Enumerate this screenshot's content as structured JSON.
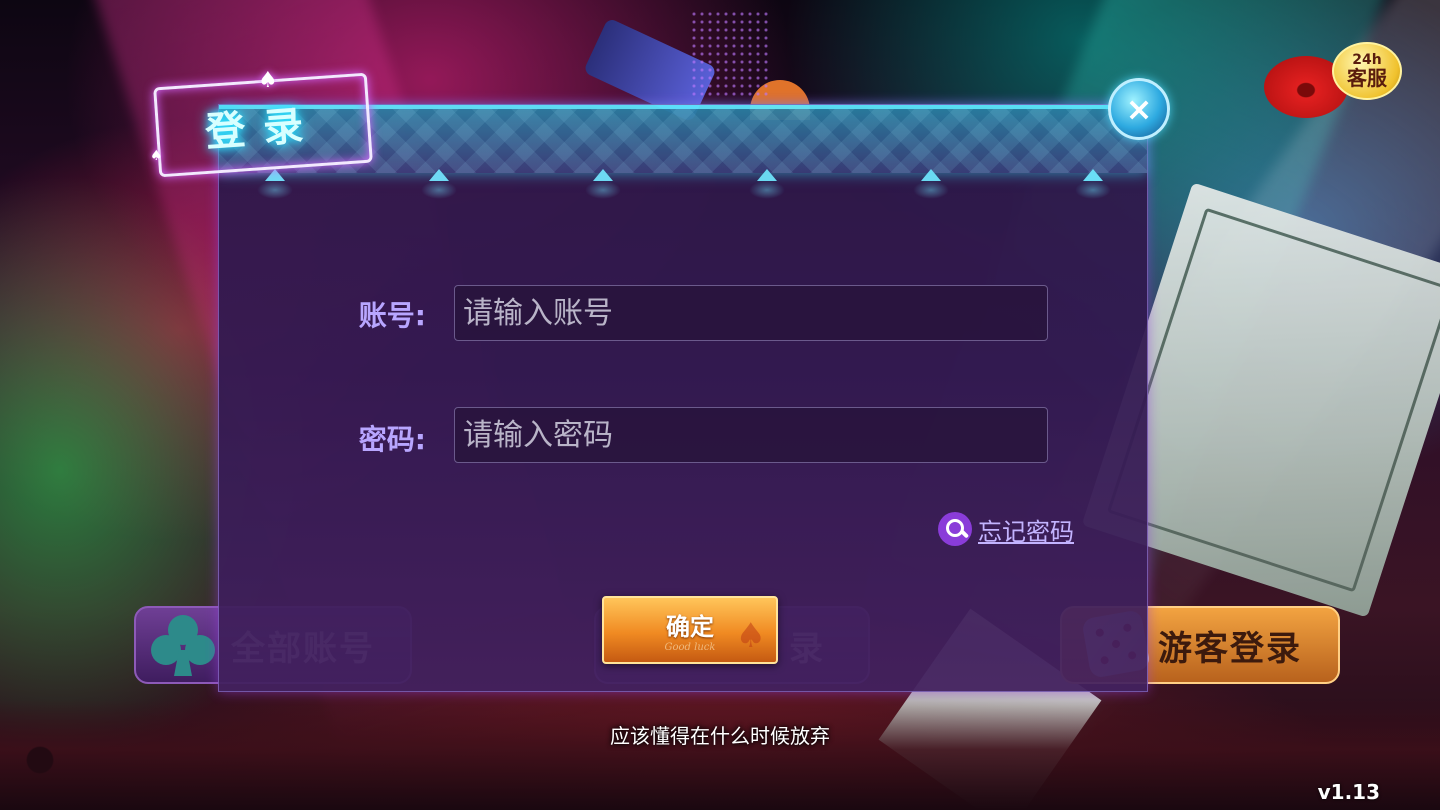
{
  "dialog": {
    "title": "登录",
    "close_label": "×",
    "account": {
      "label": "账号:",
      "placeholder": "请输入账号",
      "value": ""
    },
    "password": {
      "label": "密码:",
      "placeholder": "请输入密码",
      "value": ""
    },
    "forgot_password": "忘记密码",
    "confirm": {
      "label": "确定",
      "sub": "Good luck"
    }
  },
  "bottom_buttons": {
    "all_accounts": "全部账号",
    "middle": "录",
    "guest_login": "游客登录"
  },
  "customer_service": {
    "hours": "24h",
    "label": "客服"
  },
  "tagline": "应该懂得在什么时候放弃",
  "version": "v1.13",
  "colors": {
    "accent_cyan": "#5de8ff",
    "accent_purple": "#b8a6ff",
    "confirm_orange": "#f08a22",
    "dialog_bg": "#331a52"
  }
}
